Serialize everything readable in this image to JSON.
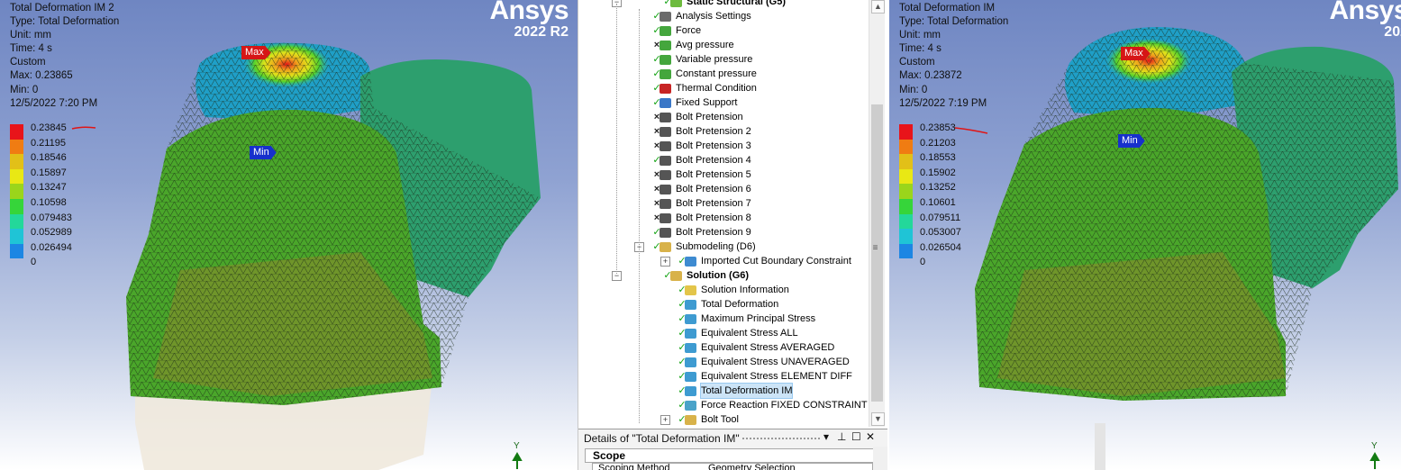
{
  "left_view": {
    "info_lines": [
      "Total Deformation IM 2",
      "Type: Total Deformation",
      "Unit: mm",
      "Time: 4 s",
      "Custom",
      "Max: 0.23865",
      "Min: 0",
      "12/5/2022 7:20 PM"
    ],
    "legend": [
      "0.23845",
      "0.21195",
      "0.18546",
      "0.15897",
      "0.13247",
      "0.10598",
      "0.079483",
      "0.052989",
      "0.026494",
      "0"
    ],
    "brand": "Ansys",
    "version": "2022 R2",
    "max_label": "Max",
    "min_label": "Min",
    "axis_label": "Y"
  },
  "right_view": {
    "info_lines": [
      "Total Deformation IM",
      "Type: Total Deformation",
      "Unit: mm",
      "Time: 4 s",
      "Custom",
      "Max: 0.23872",
      "Min: 0",
      "12/5/2022 7:19 PM"
    ],
    "legend": [
      "0.23853",
      "0.21203",
      "0.18553",
      "0.15902",
      "0.13252",
      "0.10601",
      "0.079511",
      "0.053007",
      "0.026504",
      "0"
    ],
    "brand": "Ansys",
    "version": "202",
    "max_label": "Max",
    "min_label": "Min",
    "axis_label": "Y"
  },
  "legend_colors": [
    "#e8141a",
    "#f07c12",
    "#e2c018",
    "#e9e814",
    "#9bd51b",
    "#36d53a",
    "#23d89a",
    "#1fc4d6",
    "#1c86e3",
    "#1010d8"
  ],
  "tree": {
    "items": [
      {
        "label": "Static Structural (G5)",
        "status": "ok",
        "icon": "static-structural-icon",
        "bold": true
      },
      {
        "label": "Analysis Settings",
        "status": "ok",
        "icon": "analysis-settings-icon"
      },
      {
        "label": "Force",
        "status": "ok",
        "icon": "force-icon"
      },
      {
        "label": "Avg pressure",
        "status": "x",
        "icon": "pressure-icon"
      },
      {
        "label": "Variable pressure",
        "status": "ok",
        "icon": "pressure-icon"
      },
      {
        "label": "Constant  pressure",
        "status": "ok",
        "icon": "pressure-icon"
      },
      {
        "label": "Thermal Condition",
        "status": "ok",
        "icon": "thermometer-icon"
      },
      {
        "label": "Fixed Support",
        "status": "ok",
        "icon": "fixed-support-icon"
      },
      {
        "label": "Bolt Pretension",
        "status": "x",
        "icon": "bolt-icon"
      },
      {
        "label": "Bolt Pretension 2",
        "status": "x",
        "icon": "bolt-icon"
      },
      {
        "label": "Bolt Pretension 3",
        "status": "x",
        "icon": "bolt-icon"
      },
      {
        "label": "Bolt Pretension 4",
        "status": "ok",
        "icon": "bolt-icon"
      },
      {
        "label": "Bolt Pretension 5",
        "status": "x",
        "icon": "bolt-icon"
      },
      {
        "label": "Bolt Pretension 6",
        "status": "x",
        "icon": "bolt-icon"
      },
      {
        "label": "Bolt Pretension 7",
        "status": "x",
        "icon": "bolt-icon"
      },
      {
        "label": "Bolt Pretension 8",
        "status": "x",
        "icon": "bolt-icon"
      },
      {
        "label": "Bolt Pretension 9",
        "status": "ok",
        "icon": "bolt-icon"
      },
      {
        "label": "Submodeling (D6)",
        "status": "ok",
        "icon": "folder-icon"
      },
      {
        "label": "Imported Cut Boundary Constraint",
        "status": "ok",
        "icon": "imported-constraint-icon"
      },
      {
        "label": "Solution (G6)",
        "status": "ok",
        "icon": "solution-icon",
        "bold": true
      },
      {
        "label": "Solution Information",
        "status": "ok",
        "icon": "solution-information-icon"
      },
      {
        "label": "Total Deformation",
        "status": "ok",
        "icon": "result-icon"
      },
      {
        "label": "Maximum Principal Stress",
        "status": "ok",
        "icon": "result-icon"
      },
      {
        "label": "Equivalent Stress ALL",
        "status": "ok",
        "icon": "result-icon"
      },
      {
        "label": "Equivalent Stress AVERAGED",
        "status": "ok",
        "icon": "result-icon"
      },
      {
        "label": "Equivalent Stress UNAVERAGED",
        "status": "ok",
        "icon": "result-icon"
      },
      {
        "label": "Equivalent Stress ELEMENT DIFF",
        "status": "ok",
        "icon": "result-icon"
      },
      {
        "label": "Total Deformation IM",
        "status": "ok",
        "icon": "result-icon",
        "selected": true
      },
      {
        "label": "Force Reaction FIXED CONSTRAINT",
        "status": "ok",
        "icon": "probe-icon"
      },
      {
        "label": "Bolt Tool",
        "status": "ok",
        "icon": "bolt-tool-icon"
      }
    ]
  },
  "details": {
    "title": "Details of \"Total Deformation IM\"",
    "scope_header": "Scope",
    "row_name": "Scoping Method",
    "row_value": "Geometry Selection"
  }
}
